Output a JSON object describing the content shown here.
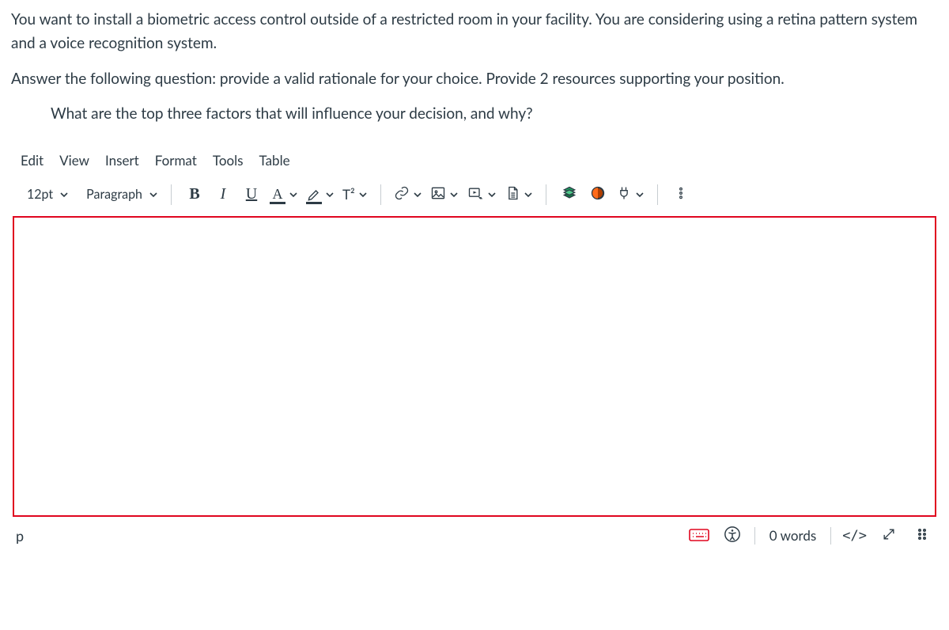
{
  "question": {
    "para1": "You want to install a biometric access control outside of a restricted room in your facility. You are considering using a retina pattern system and a voice recognition system.",
    "para2": "Answer the following question: provide a valid rationale for your choice. Provide 2 resources supporting your position.",
    "para3": "What are the top three factors that will influence your decision, and why?"
  },
  "menubar": {
    "edit": "Edit",
    "view": "View",
    "insert": "Insert",
    "format": "Format",
    "tools": "Tools",
    "table": "Table"
  },
  "toolbar": {
    "font_size": "12pt",
    "block_type": "Paragraph",
    "bold": "B",
    "italic": "I",
    "underline": "U",
    "text_color_letter": "A",
    "super_label": "T²"
  },
  "plugins": {
    "office_color": "#107c41",
    "kaltura_color": "#e8632c"
  },
  "status": {
    "path": "p",
    "word_count": "0 words",
    "html_toggle": "</>"
  }
}
